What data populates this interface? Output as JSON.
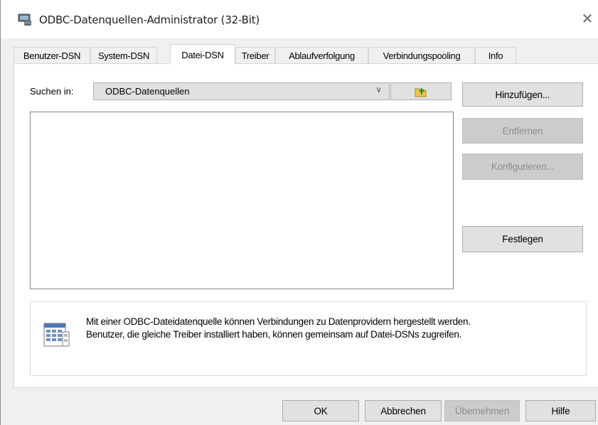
{
  "window": {
    "title": "ODBC-Datenquellen-Administrator (32-Bit)",
    "close_glyph": "✕"
  },
  "tabs": [
    {
      "label": "Benutzer-DSN",
      "active": false
    },
    {
      "label": "System-DSN",
      "active": false
    },
    {
      "label": "Datei-DSN",
      "active": true
    },
    {
      "label": "Treiber",
      "active": false
    },
    {
      "label": "Ablaufverfolgung",
      "active": false
    },
    {
      "label": "Verbindungspooling",
      "active": false
    },
    {
      "label": "Info",
      "active": false
    }
  ],
  "lookin": {
    "label": "Suchen in:",
    "value": "ODBC-Datenquellen",
    "arrow": "∨"
  },
  "side_buttons": {
    "add": "Hinzufügen...",
    "remove": "Entfernen",
    "configure": "Konfigurieren...",
    "set": "Festlegen"
  },
  "info": {
    "line1": "Mit einer ODBC-Dateidatenquelle können Verbindungen zu Datenprovidern hergestellt werden.",
    "line2": "Benutzer, die gleiche Treiber installiert haben, können gemeinsam auf Datei-DSNs zugreifen."
  },
  "footer": {
    "ok": "OK",
    "cancel": "Abbrechen",
    "apply": "Übernehmen",
    "help": "Hilfe"
  },
  "colors": {
    "button_face": "#e1e1e1",
    "disabled_face": "#cccccc",
    "disabled_text": "#8d8d8d",
    "folder_icon": "#e8c64a"
  }
}
